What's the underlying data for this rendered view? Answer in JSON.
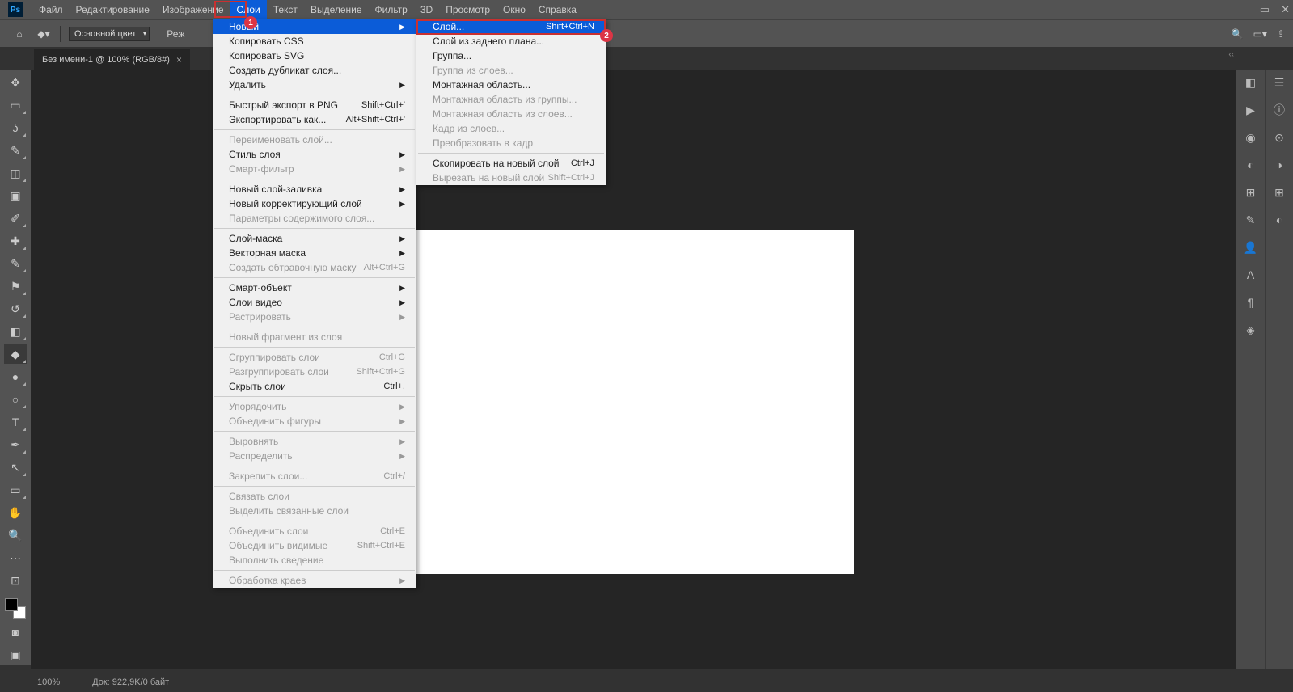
{
  "menubar": [
    "Файл",
    "Редактирование",
    "Изображение",
    "Слои",
    "Текст",
    "Выделение",
    "Фильтр",
    "3D",
    "Просмотр",
    "Окно",
    "Справка"
  ],
  "optbar": {
    "mode_label": "Основной цвет",
    "mode2": "Реж"
  },
  "tab": {
    "title": "Без имени-1 @ 100% (RGB/8#)"
  },
  "status": {
    "zoom": "100%",
    "doc": "Док: 922,9K/0 байт"
  },
  "menu1": [
    {
      "t": "item",
      "label": "Новый",
      "arrow": true,
      "hi": true
    },
    {
      "t": "item",
      "label": "Копировать CSS"
    },
    {
      "t": "item",
      "label": "Копировать SVG"
    },
    {
      "t": "item",
      "label": "Создать дубликат слоя..."
    },
    {
      "t": "item",
      "label": "Удалить",
      "arrow": true
    },
    {
      "t": "sep"
    },
    {
      "t": "item",
      "label": "Быстрый экспорт в PNG",
      "sc": "Shift+Ctrl+'"
    },
    {
      "t": "item",
      "label": "Экспортировать как...",
      "sc": "Alt+Shift+Ctrl+'"
    },
    {
      "t": "sep"
    },
    {
      "t": "item",
      "label": "Переименовать слой...",
      "disabled": true
    },
    {
      "t": "item",
      "label": "Стиль слоя",
      "arrow": true
    },
    {
      "t": "item",
      "label": "Смарт-фильтр",
      "arrow": true,
      "disabled": true
    },
    {
      "t": "sep"
    },
    {
      "t": "item",
      "label": "Новый слой-заливка",
      "arrow": true
    },
    {
      "t": "item",
      "label": "Новый корректирующий слой",
      "arrow": true
    },
    {
      "t": "item",
      "label": "Параметры содержимого слоя...",
      "disabled": true
    },
    {
      "t": "sep"
    },
    {
      "t": "item",
      "label": "Слой-маска",
      "arrow": true
    },
    {
      "t": "item",
      "label": "Векторная маска",
      "arrow": true
    },
    {
      "t": "item",
      "label": "Создать обтравочную маску",
      "sc": "Alt+Ctrl+G",
      "disabled": true
    },
    {
      "t": "sep"
    },
    {
      "t": "item",
      "label": "Смарт-объект",
      "arrow": true
    },
    {
      "t": "item",
      "label": "Слои видео",
      "arrow": true
    },
    {
      "t": "item",
      "label": "Растрировать",
      "arrow": true,
      "disabled": true
    },
    {
      "t": "sep"
    },
    {
      "t": "item",
      "label": "Новый фрагмент из слоя",
      "disabled": true
    },
    {
      "t": "sep"
    },
    {
      "t": "item",
      "label": "Сгруппировать слои",
      "sc": "Ctrl+G",
      "disabled": true
    },
    {
      "t": "item",
      "label": "Разгруппировать слои",
      "sc": "Shift+Ctrl+G",
      "disabled": true
    },
    {
      "t": "item",
      "label": "Скрыть слои",
      "sc": "Ctrl+,"
    },
    {
      "t": "sep"
    },
    {
      "t": "item",
      "label": "Упорядочить",
      "arrow": true,
      "disabled": true
    },
    {
      "t": "item",
      "label": "Объединить фигуры",
      "arrow": true,
      "disabled": true
    },
    {
      "t": "sep"
    },
    {
      "t": "item",
      "label": "Выровнять",
      "arrow": true,
      "disabled": true
    },
    {
      "t": "item",
      "label": "Распределить",
      "arrow": true,
      "disabled": true
    },
    {
      "t": "sep"
    },
    {
      "t": "item",
      "label": "Закрепить слои...",
      "sc": "Ctrl+/",
      "disabled": true
    },
    {
      "t": "sep"
    },
    {
      "t": "item",
      "label": "Связать слои",
      "disabled": true
    },
    {
      "t": "item",
      "label": "Выделить связанные слои",
      "disabled": true
    },
    {
      "t": "sep"
    },
    {
      "t": "item",
      "label": "Объединить слои",
      "sc": "Ctrl+E",
      "disabled": true
    },
    {
      "t": "item",
      "label": "Объединить видимые",
      "sc": "Shift+Ctrl+E",
      "disabled": true
    },
    {
      "t": "item",
      "label": "Выполнить сведение",
      "disabled": true
    },
    {
      "t": "sep"
    },
    {
      "t": "item",
      "label": "Обработка краев",
      "arrow": true,
      "disabled": true
    }
  ],
  "menu2": [
    {
      "t": "item",
      "label": "Слой...",
      "sc": "Shift+Ctrl+N",
      "hi": true
    },
    {
      "t": "item",
      "label": "Слой из заднего плана..."
    },
    {
      "t": "item",
      "label": "Группа..."
    },
    {
      "t": "item",
      "label": "Группа из слоев...",
      "disabled": true
    },
    {
      "t": "item",
      "label": "Монтажная область..."
    },
    {
      "t": "item",
      "label": "Монтажная область из группы...",
      "disabled": true
    },
    {
      "t": "item",
      "label": "Монтажная область из слоев...",
      "disabled": true
    },
    {
      "t": "item",
      "label": "Кадр из слоев...",
      "disabled": true
    },
    {
      "t": "item",
      "label": "Преобразовать в кадр",
      "disabled": true
    },
    {
      "t": "sep"
    },
    {
      "t": "item",
      "label": "Скопировать на новый слой",
      "sc": "Ctrl+J"
    },
    {
      "t": "item",
      "label": "Вырезать на новый слой",
      "sc": "Shift+Ctrl+J",
      "disabled": true
    }
  ],
  "badges": {
    "b1": "1",
    "b2": "2"
  },
  "tools": [
    {
      "name": "move-tool",
      "glyph": "✥"
    },
    {
      "name": "marquee-tool",
      "glyph": "▭",
      "caret": true
    },
    {
      "name": "lasso-tool",
      "glyph": "ʖ",
      "caret": true
    },
    {
      "name": "quick-select-tool",
      "glyph": "✎",
      "caret": true
    },
    {
      "name": "crop-tool",
      "glyph": "◫",
      "caret": true
    },
    {
      "name": "frame-tool",
      "glyph": "▣"
    },
    {
      "name": "eyedropper-tool",
      "glyph": "✐",
      "caret": true
    },
    {
      "name": "healing-tool",
      "glyph": "✚",
      "caret": true
    },
    {
      "name": "brush-tool",
      "glyph": "✎",
      "caret": true
    },
    {
      "name": "stamp-tool",
      "glyph": "⚑",
      "caret": true
    },
    {
      "name": "history-brush-tool",
      "glyph": "↺",
      "caret": true
    },
    {
      "name": "eraser-tool",
      "glyph": "◧",
      "caret": true
    },
    {
      "name": "bucket-tool",
      "glyph": "◆",
      "caret": true,
      "active": true
    },
    {
      "name": "blur-tool",
      "glyph": "●",
      "caret": true
    },
    {
      "name": "dodge-tool",
      "glyph": "○",
      "caret": true
    },
    {
      "name": "type-tool",
      "glyph": "T",
      "caret": true
    },
    {
      "name": "pen-tool",
      "glyph": "✒",
      "caret": true
    },
    {
      "name": "path-select-tool",
      "glyph": "↖",
      "caret": true
    },
    {
      "name": "shape-tool",
      "glyph": "▭",
      "caret": true
    },
    {
      "name": "hand-tool",
      "glyph": "✋"
    },
    {
      "name": "zoom-tool",
      "glyph": "🔍"
    },
    {
      "name": "more-tool",
      "glyph": "⋯"
    },
    {
      "name": "edit-toolbar",
      "glyph": "⊡"
    }
  ],
  "rp_left": [
    "◧",
    "▶",
    "◉",
    "◐",
    "⊞",
    "✎",
    "👤",
    "A",
    "¶",
    "◈"
  ],
  "rp_right": [
    "☰",
    "ⓘ",
    "⊙",
    "◑",
    "⊞",
    "◐"
  ]
}
